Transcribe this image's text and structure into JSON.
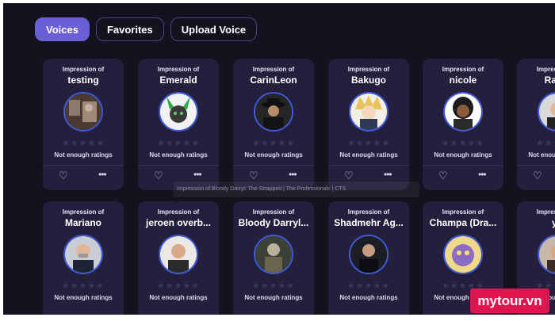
{
  "tabs": [
    {
      "label": "Voices",
      "active": true
    },
    {
      "label": "Favorites",
      "active": false
    },
    {
      "label": "Upload Voice",
      "active": false
    }
  ],
  "card_prefix": "Impression of",
  "rating_text": "Not enough ratings",
  "row1": [
    {
      "name": "testing"
    },
    {
      "name": "Emerald"
    },
    {
      "name": "CarinLeon"
    },
    {
      "name": "Bakugo"
    },
    {
      "name": "nicole"
    },
    {
      "name": "Rajoy"
    }
  ],
  "row2": [
    {
      "name": "Mariano"
    },
    {
      "name": "jeroen overb..."
    },
    {
      "name": "Bloody Darryl..."
    },
    {
      "name": "Shadmehr Ag..."
    },
    {
      "name": "Champa (Dra..."
    },
    {
      "name": "yo"
    }
  ],
  "tooltip": "Impression of Bloody Darryl: The Strapped | The Professionals | CTS",
  "watermark": "mytour.vn",
  "colors": {
    "background": "#14121f",
    "card": "#241f3d",
    "accent": "#6a5fd4",
    "avatar_ring": "#3d5bd9",
    "watermark": "#e0144f"
  }
}
